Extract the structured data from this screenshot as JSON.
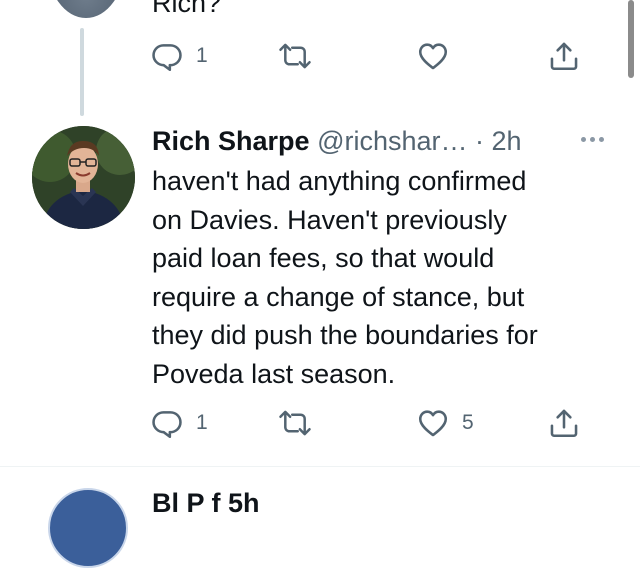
{
  "previous_tweet": {
    "text_fragment": "Rich?",
    "reply_count": "1",
    "like_count": ""
  },
  "tweet": {
    "display_name": "Rich Sharpe",
    "handle": "@richshar…",
    "separator": " · ",
    "time": "2h",
    "lines": [
      "haven't had anything confirmed",
      "on Davies. Haven't previously",
      "paid loan fees, so that would",
      "require a change of stance, but",
      "they did push the boundaries for",
      "Poveda last season."
    ],
    "reply_count": "1",
    "like_count": "5"
  },
  "next_tweet": {
    "text_fragment": "Bl           P          f     5h"
  },
  "icons": {
    "reply": "reply-icon",
    "retweet": "retweet-icon",
    "like": "heart-icon",
    "share": "share-icon",
    "more": "more-icon"
  },
  "colors": {
    "text": "#0f1419",
    "secondary": "#536471",
    "thread_line": "#cfd9de",
    "divider": "#eff3f4"
  }
}
